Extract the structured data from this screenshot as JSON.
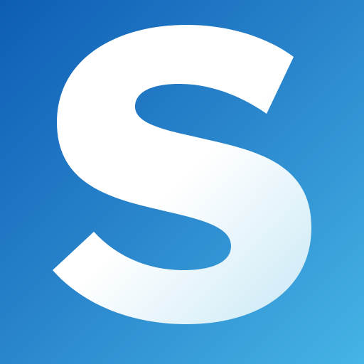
{
  "app_icon": {
    "logo_letter": "S",
    "icon_name": "s-logo-icon",
    "colors": {
      "background_top_left": "#0d5db5",
      "background_bottom_right": "#45b4e6",
      "letter_fill": "#ffffff",
      "letter_tint": "#cdeaf6"
    }
  }
}
